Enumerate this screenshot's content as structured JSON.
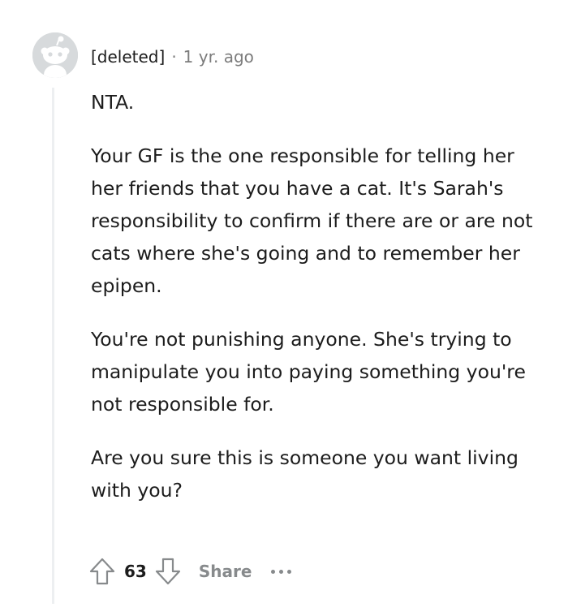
{
  "comment": {
    "author": "[deleted]",
    "separator": "·",
    "time": "1 yr. ago",
    "paragraphs": [
      "NTA.",
      "Your GF is the one responsible for telling her her friends that you have a cat. It's Sarah's responsibility to confirm if there are or are not cats where she's going and to remember her epipen.",
      "You're not punishing anyone. She's trying to manipulate you into paying something you're not responsible for.",
      "Are you sure this is someone you want living with you?"
    ],
    "score": "63",
    "share_label": "Share"
  },
  "icons": {
    "avatar": "snoo-avatar-icon",
    "upvote": "upvote-arrow-icon",
    "downvote": "downvote-arrow-icon",
    "more": "more-options-icon"
  },
  "colors": {
    "meta_gray": "#7c7c7c",
    "action_gray": "#878a8c",
    "thread_line": "#edeff1",
    "avatar_bg": "#d7dadc"
  }
}
